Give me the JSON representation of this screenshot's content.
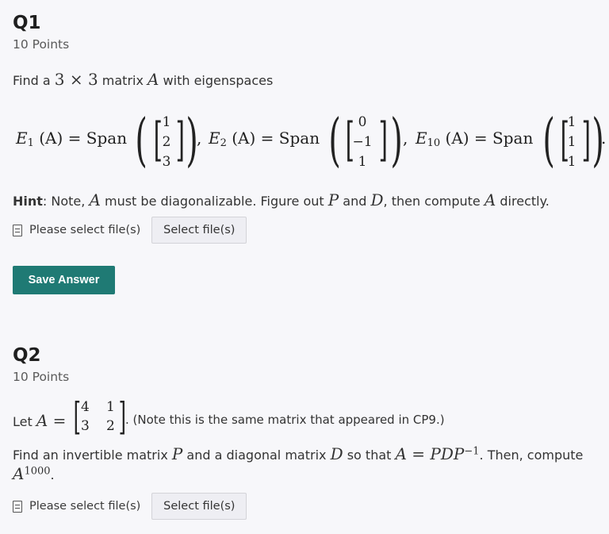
{
  "q1": {
    "title": "Q1",
    "points": "10 Points",
    "intro_before": "Find a ",
    "intro_math": "3 × 3",
    "intro_mid": " matrix ",
    "intro_var": "A",
    "intro_after": " with eigenspaces",
    "eigenspaces": [
      {
        "label": "E",
        "sub": "1",
        "arg": "(A) = Span",
        "vector": [
          "1",
          "2",
          "3"
        ]
      },
      {
        "label": "E",
        "sub": "2",
        "arg": "(A) = Span",
        "vector": [
          "0",
          "−1",
          "1"
        ]
      },
      {
        "label": "E",
        "sub": "10",
        "arg": "(A) = Span",
        "vector": [
          "1",
          "1",
          "1"
        ]
      }
    ],
    "hint_label": "Hint",
    "hint_text_1": ": Note, ",
    "hint_var_a": "A",
    "hint_text_2": " must be diagonalizable. Figure out ",
    "hint_var_p": "P",
    "hint_text_3": " and ",
    "hint_var_d": "D",
    "hint_text_4": ", then compute ",
    "hint_var_a2": "A",
    "hint_text_5": " directly.",
    "file_label": "Please select file(s)",
    "file_button": "Select file(s)",
    "save_button": "Save Answer"
  },
  "q2": {
    "title": "Q2",
    "points": "10 Points",
    "let_text": "Let ",
    "let_var": "A",
    "equals": " = ",
    "matrix": [
      [
        "4",
        "1"
      ],
      [
        "3",
        "2"
      ]
    ],
    "note": ". (Note this is the same matrix that appeared in CP9.)",
    "find_1": "Find an invertible matrix ",
    "find_var_p": "P",
    "find_2": " and a diagonal matrix ",
    "find_var_d": "D",
    "find_3": " so that ",
    "find_eq": "A = PDP",
    "find_exp": "−1",
    "find_4": ". Then, compute",
    "power_base": "A",
    "power_exp": "1000",
    "power_end": ".",
    "file_label": "Please select file(s)",
    "file_button": "Select file(s)"
  }
}
